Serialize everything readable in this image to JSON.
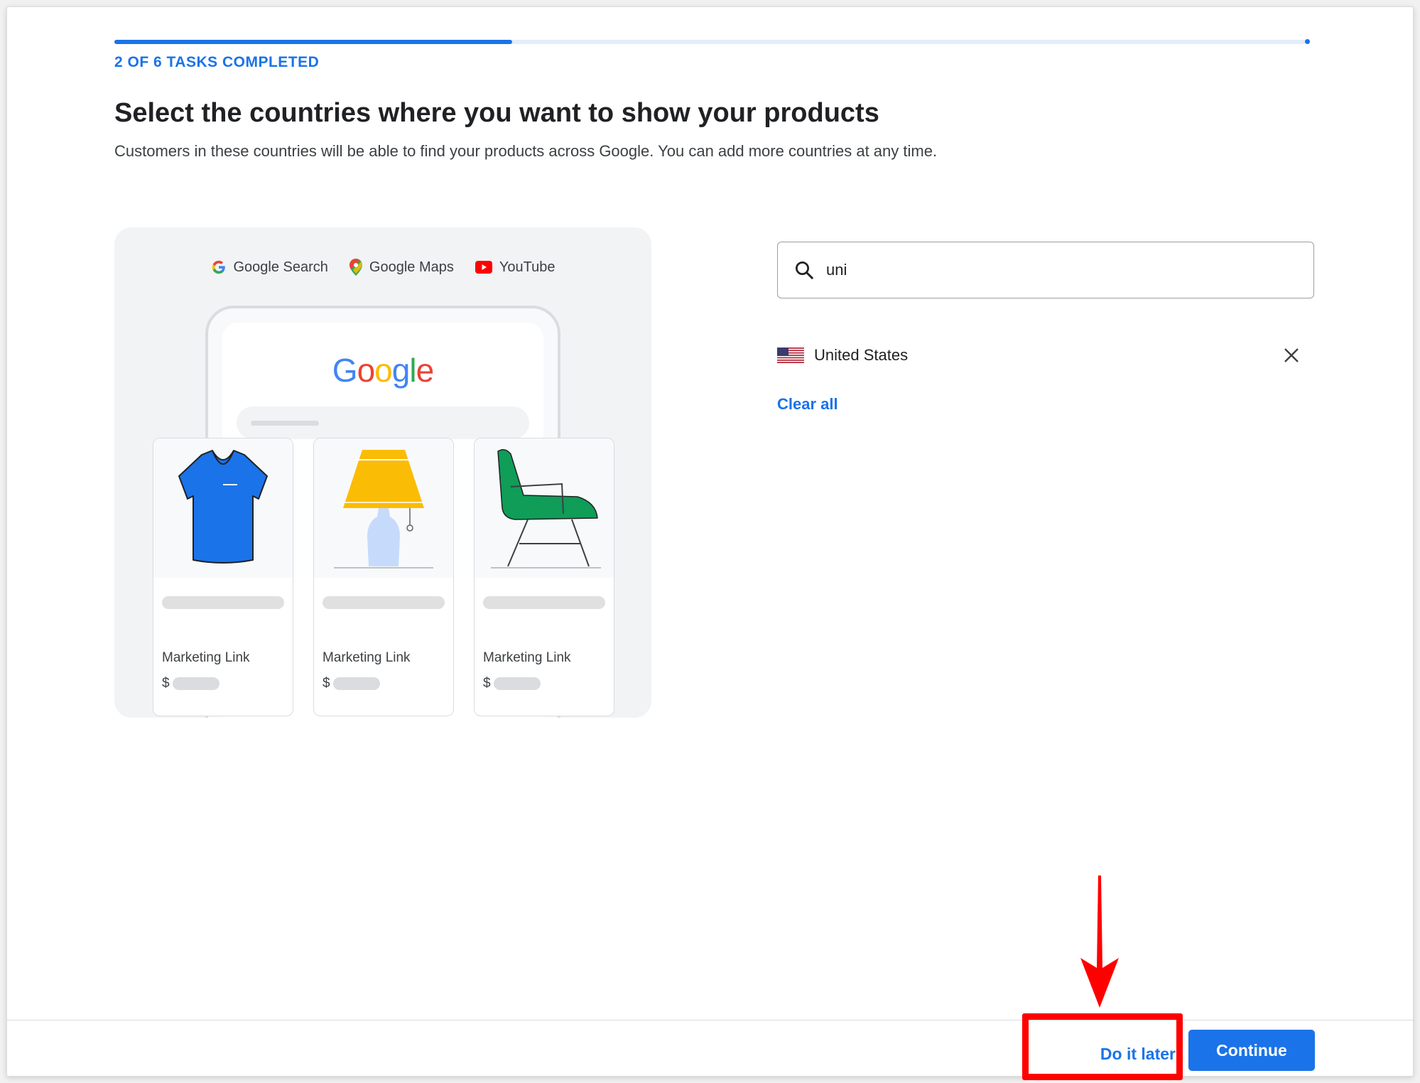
{
  "progress": {
    "label": "2 OF 6 TASKS COMPLETED",
    "completed": 2,
    "total": 6
  },
  "header": {
    "title": "Select the countries where you want to show your products",
    "subtitle": "Customers in these countries will be able to find your products across Google. You can add more countries at any time."
  },
  "illustration": {
    "surfaces": [
      {
        "label": "Google Search",
        "icon": "google-g-icon"
      },
      {
        "label": "Google Maps",
        "icon": "maps-pin-icon"
      },
      {
        "label": "YouTube",
        "icon": "youtube-icon"
      }
    ],
    "logo_text": "Google",
    "cards": [
      {
        "name": "Marketing Link",
        "currency": "$",
        "image": "tshirt-icon"
      },
      {
        "name": "Marketing Link",
        "currency": "$",
        "image": "lamp-icon"
      },
      {
        "name": "Marketing Link",
        "currency": "$",
        "image": "chair-icon"
      }
    ]
  },
  "country_search": {
    "value": "uni",
    "icon": "search-icon"
  },
  "selected_countries": [
    {
      "name": "United States",
      "flag": "us-flag-icon"
    }
  ],
  "clear_all_label": "Clear all",
  "footer": {
    "do_it_later_label": "Do it later",
    "continue_label": "Continue"
  },
  "colors": {
    "accent": "#1a73e8",
    "annotation": "#ff0000"
  }
}
